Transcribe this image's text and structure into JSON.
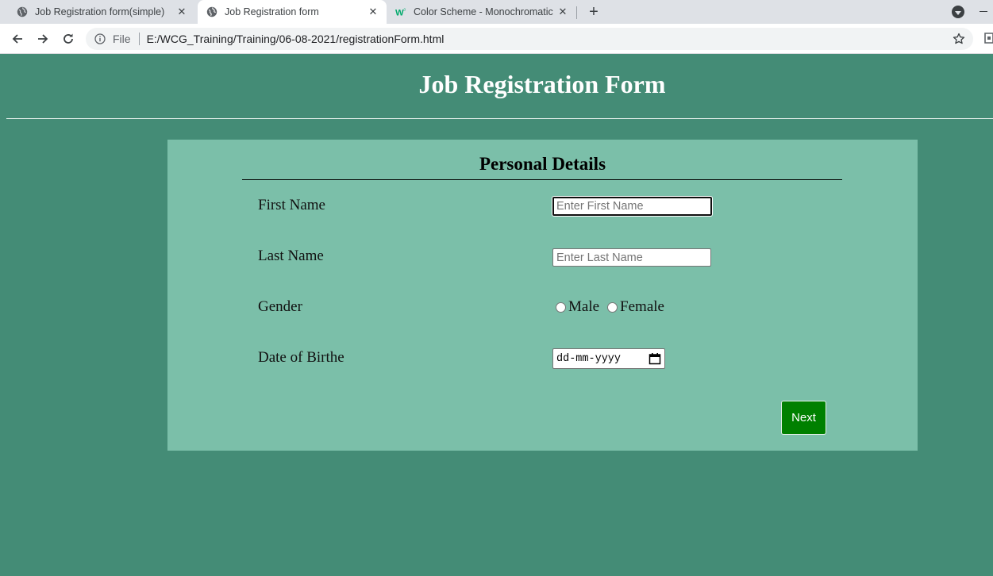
{
  "browser": {
    "tabs": [
      {
        "title": "Job Registration form(simple)",
        "favicon": "globe-icon"
      },
      {
        "title": "Job Registration form",
        "favicon": "globe-icon",
        "active": true
      },
      {
        "title": "Color Scheme - Monochromatic",
        "favicon": "w3schools-icon"
      }
    ],
    "address": {
      "scheme_label": "File",
      "url": "E:/WCG_Training/Training/06-08-2021/registrationForm.html"
    }
  },
  "page": {
    "title": "Job Registration Form",
    "background_color": "#448c76",
    "card_color": "#7bbfa9"
  },
  "form": {
    "section_title": "Personal Details",
    "first_name": {
      "label": "First Name",
      "placeholder": "Enter First Name",
      "value": ""
    },
    "last_name": {
      "label": "Last Name",
      "placeholder": "Enter Last Name",
      "value": ""
    },
    "gender": {
      "label": "Gender",
      "options": [
        "Male",
        "Female"
      ]
    },
    "dob": {
      "label": "Date of Birthe",
      "placeholder": "dd-mm-yyyy"
    },
    "next_label": "Next",
    "next_color": "#008000"
  }
}
